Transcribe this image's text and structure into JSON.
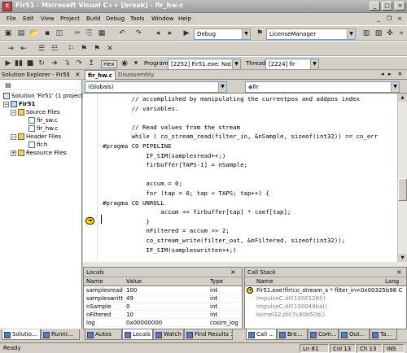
{
  "window": {
    "title": "Fir51 - Microsoft Visual C++ [break] - fir_hw.c",
    "app_icon": "vc-app-icon",
    "controls": [
      "_",
      "□",
      "×"
    ]
  },
  "menu": {
    "items": [
      "File",
      "Edit",
      "View",
      "Project",
      "Build",
      "Debug",
      "Tools",
      "Window",
      "Help"
    ]
  },
  "toolbar1": {
    "config_value": "Debug",
    "project_value": "LicenseManager"
  },
  "toolbar2": {
    "hex_label": "Hex",
    "program_label": "Program",
    "program_value": "[2252] Fir51.exe: Nativ",
    "thread_label": "Thread",
    "thread_value": "[2224] fir"
  },
  "solution_explorer": {
    "title": "Solution Explorer - Fir51",
    "solution": "Solution 'Fir51' (1 project)",
    "project": "Fir51",
    "folders": [
      {
        "name": "Source Files",
        "files": [
          "fir_sw.c",
          "fir_hw.c"
        ]
      },
      {
        "name": "Header Files",
        "files": [
          "fir.h"
        ]
      },
      {
        "name": "Resource Files",
        "files": []
      }
    ]
  },
  "editor": {
    "tabs": [
      "fir_hw.c",
      "Disassembly"
    ],
    "scope_combo": "(Globals)",
    "member_combo": "fir",
    "lines": [
      "        // accomplished by manipulating the currentpos and addpos index",
      "        // variables.",
      "",
      "        // Read values from the stream",
      "        while ( co_stream_read(filter_in, &nSample, sizeof(int32)) == co_err",
      "#pragma CO PIPELINE",
      "            IF_SIM(samplesread++;)",
      "            firbuffer[TAPS-1] = nSample;",
      "",
      "            accum = 0;",
      "            for (tap = 0; tap < TAPS; tap++) {",
      "#pragma CO UNROLL",
      "                accum += firbuffer[tap] * coef[tap];",
      "            }",
      "            nFiltered = accum >> 2;",
      "            co_stream_write(filter_out, &nFiltered, sizeof(int32));",
      "            IF_SIM(sampleswritten++;)"
    ],
    "current_line_index": 14
  },
  "locals": {
    "title": "Locals",
    "columns": [
      "Name",
      "Value",
      "Type"
    ],
    "rows": [
      {
        "name": "samplesread",
        "value": "100",
        "type": "int"
      },
      {
        "name": "sampleswritt",
        "value": "49",
        "type": "int"
      },
      {
        "name": "nSample",
        "value": "0",
        "type": "int"
      },
      {
        "name": "nFiltered",
        "value": "10",
        "type": "int"
      },
      {
        "name": "log",
        "value": "0x00000000",
        "type": "cosim_log"
      }
    ]
  },
  "callstack": {
    "title": "Call Stack",
    "columns": [
      "Name",
      "Lang"
    ],
    "rows": [
      "Fir51.exe!fir(co_stream_s * filter_in=0x00325b98 C",
      "ImpulseC.dll!1000126f()",
      "ImpulseC.dll!100049ba()",
      "kernel32.dll!7c80b50b()"
    ]
  },
  "bottom_tabs_left": [
    "Solutio...",
    "Runni..."
  ],
  "bottom_tabs_mid": [
    "Autos",
    "Locals",
    "Watch 1",
    "Find Results 1"
  ],
  "bottom_tabs_right": [
    "Call ...",
    "Bre...",
    "Com...",
    "Out...",
    "Ta..."
  ],
  "status": {
    "text": "Ready",
    "ln": "Ln 81",
    "col": "Col 13",
    "ch": "Ch 13",
    "mode": "INS"
  }
}
